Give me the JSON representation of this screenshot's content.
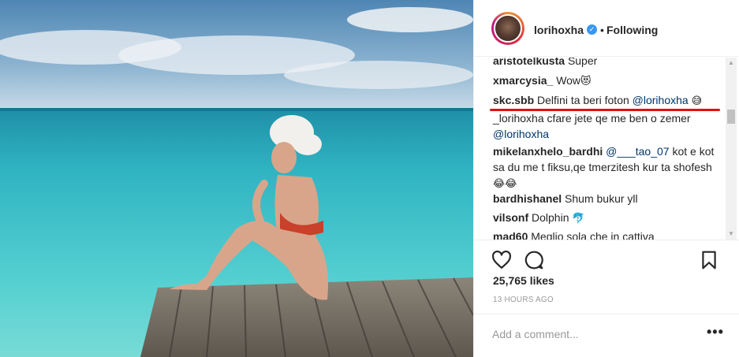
{
  "post": {
    "username": "lorihoxha",
    "follow_status": "Following",
    "separator": "•",
    "likes": "25,765 likes",
    "time": "13 HOURS AGO",
    "comment_placeholder": "Add a comment...",
    "more": "•••"
  },
  "comments": [
    {
      "user": "aristotelkusta",
      "text": "Super",
      "emoji": ""
    },
    {
      "user": "xmarcysia_",
      "text": "Wow",
      "emoji": "😻"
    },
    {
      "user": "skc.sbb",
      "text": "Delfini ta beri foton ",
      "mention": "@lorihoxha",
      "emoji": "😅"
    },
    {
      "user": "_lorihoxha",
      "text": "cfare jete qe me ben o zemer ",
      "mention": "@lorihoxha",
      "emoji": ""
    },
    {
      "user": "mikelanxhelo_bardhi",
      "mention": "@___tao_07",
      "text": " kot e kot sa du me t fiksu,qe tmerzitesh kur ta shofesh",
      "emoji": "😂😂"
    },
    {
      "user": "bardhishanel",
      "text": "Shum bukur yll",
      "emoji": ""
    },
    {
      "user": "vilsonf",
      "text": "Dolphin",
      "emoji": "🐬"
    },
    {
      "user": "mad60",
      "text": "Meglio sola che in cattiva",
      "emoji": ""
    }
  ],
  "colors": {
    "mention": "#003569",
    "verified": "#3897f0",
    "highlight": "#e01010"
  },
  "icons": [
    "heart-icon",
    "comment-icon",
    "bookmark-icon",
    "verified-badge-icon",
    "more-options-icon"
  ]
}
